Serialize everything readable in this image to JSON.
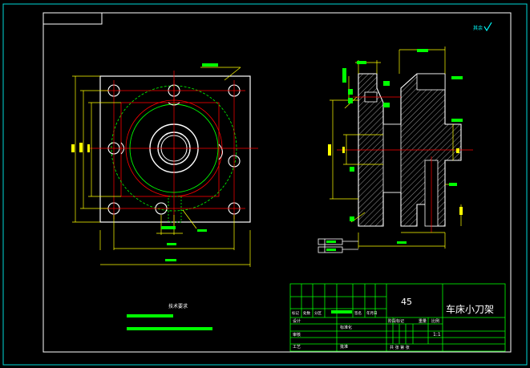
{
  "drawing": {
    "part_name": "车床小刀架",
    "material": "45",
    "scale": "1:1",
    "technical_requirements_title": "技术要求",
    "roughness_symbol_label": "其余"
  },
  "title_block": {
    "row_labels": [
      "标记",
      "处数",
      "分区",
      "更改文件号",
      "签名",
      "年月日"
    ],
    "design_label": "设计",
    "standardization_label": "标准化",
    "review_label": "审核",
    "process_label": "工艺",
    "approve_label": "批准",
    "stage_label": "阶段标记",
    "weight_label": "重量",
    "scale_label": "比例",
    "sheet_label": "共 张 第 张"
  },
  "colors": {
    "background": "#000000",
    "frame": "#00d8d8",
    "border": "#ffffff",
    "outline": "#ffffff",
    "dimension": "#ffff00",
    "centerline": "#ff0000",
    "hidden": "#00ff00",
    "label_highlight": "#00ff00",
    "hatch": "#ffffff"
  }
}
